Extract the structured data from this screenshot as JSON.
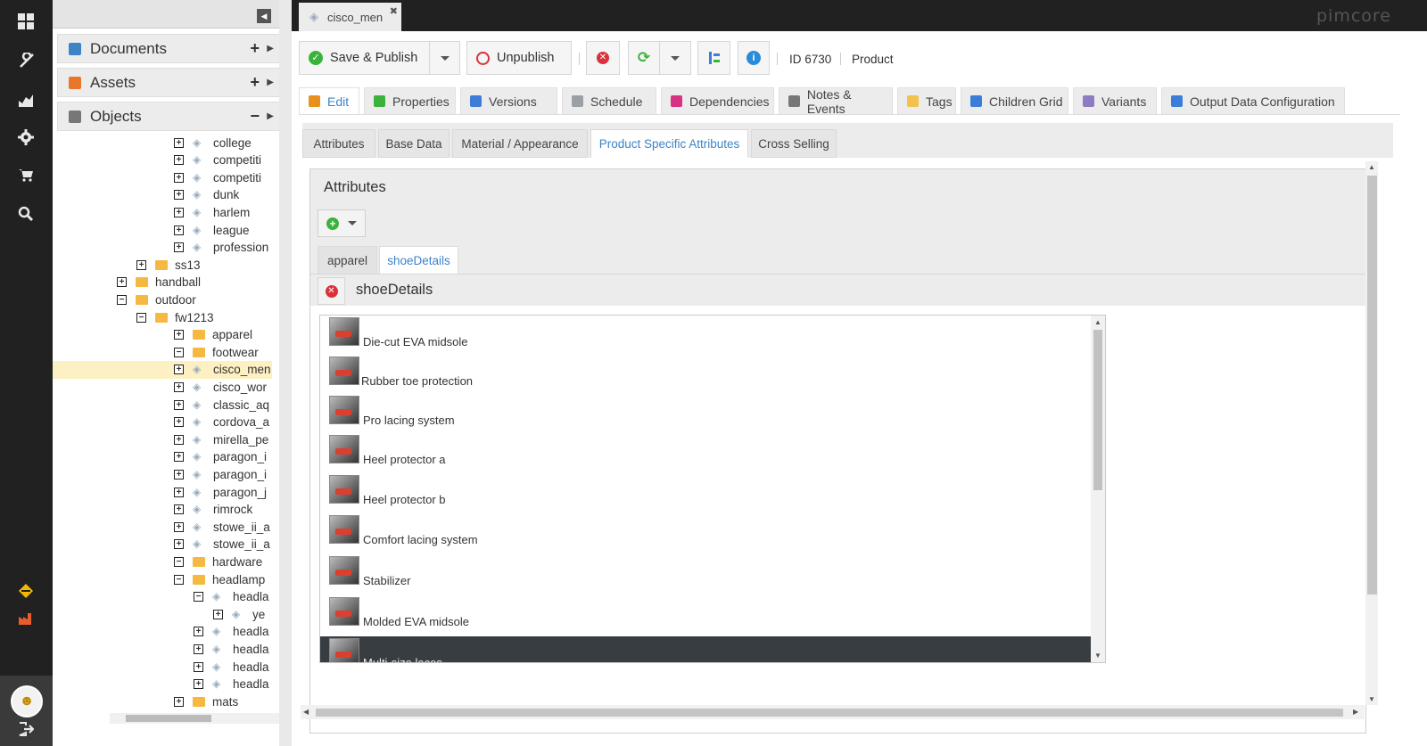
{
  "app": {
    "logo": "pimcore"
  },
  "doc_tab": {
    "title": "cisco_men",
    "close": "✖"
  },
  "accordion": {
    "documents": "Documents",
    "assets": "Assets",
    "objects": "Objects"
  },
  "tree": [
    {
      "label": "college",
      "toggle": "+",
      "icon": "tag",
      "indent": 3
    },
    {
      "label": "competiti",
      "toggle": "+",
      "icon": "tag",
      "indent": 3
    },
    {
      "label": "competiti",
      "toggle": "+",
      "icon": "tag",
      "indent": 3
    },
    {
      "label": "dunk",
      "toggle": "+",
      "icon": "tag",
      "indent": 3
    },
    {
      "label": "harlem",
      "toggle": "+",
      "icon": "tag",
      "indent": 3
    },
    {
      "label": "league",
      "toggle": "+",
      "icon": "tag",
      "indent": 3
    },
    {
      "label": "profession",
      "toggle": "+",
      "icon": "tag",
      "indent": 3
    },
    {
      "label": "ss13",
      "toggle": "+",
      "icon": "folder",
      "indent": 2
    },
    {
      "label": "handball",
      "toggle": "+",
      "icon": "folder",
      "indent": 1
    },
    {
      "label": "outdoor",
      "toggle": "−",
      "icon": "folder",
      "indent": 1
    },
    {
      "label": "fw1213",
      "toggle": "−",
      "icon": "folder",
      "indent": 2
    },
    {
      "label": "apparel",
      "toggle": "+",
      "icon": "folder",
      "indent": 3
    },
    {
      "label": "footwear",
      "toggle": "−",
      "icon": "folder",
      "indent": 3
    },
    {
      "label": "cisco_men",
      "toggle": "+",
      "icon": "tag",
      "indent": 4,
      "selected": true
    },
    {
      "label": "cisco_wor",
      "toggle": "+",
      "icon": "tag",
      "indent": 4
    },
    {
      "label": "classic_aq",
      "toggle": "+",
      "icon": "tag",
      "indent": 4
    },
    {
      "label": "cordova_a",
      "toggle": "+",
      "icon": "tag",
      "indent": 4
    },
    {
      "label": "mirella_pe",
      "toggle": "+",
      "icon": "tag",
      "indent": 4
    },
    {
      "label": "paragon_i",
      "toggle": "+",
      "icon": "tag",
      "indent": 4
    },
    {
      "label": "paragon_i",
      "toggle": "+",
      "icon": "tag",
      "indent": 4
    },
    {
      "label": "paragon_j",
      "toggle": "+",
      "icon": "tag",
      "indent": 4
    },
    {
      "label": "rimrock",
      "toggle": "+",
      "icon": "tag",
      "indent": 4
    },
    {
      "label": "stowe_ii_a",
      "toggle": "+",
      "icon": "tag",
      "indent": 4
    },
    {
      "label": "stowe_ii_a",
      "toggle": "+",
      "icon": "tag",
      "indent": 4
    },
    {
      "label": "hardware",
      "toggle": "−",
      "icon": "folder",
      "indent": 3
    },
    {
      "label": "headlamp",
      "toggle": "−",
      "icon": "folder",
      "indent": 4
    },
    {
      "label": "headla",
      "toggle": "−",
      "icon": "tag",
      "indent": 5
    },
    {
      "label": "ye",
      "toggle": "+",
      "icon": "tag",
      "indent": 6
    },
    {
      "label": "headla",
      "toggle": "+",
      "icon": "tag",
      "indent": 5
    },
    {
      "label": "headla",
      "toggle": "+",
      "icon": "tag",
      "indent": 5
    },
    {
      "label": "headla",
      "toggle": "+",
      "icon": "tag",
      "indent": 5
    },
    {
      "label": "headla",
      "toggle": "+",
      "icon": "tag",
      "indent": 5
    },
    {
      "label": "mats",
      "toggle": "+",
      "icon": "folder",
      "indent": 4
    }
  ],
  "toolbar": {
    "save_publish": "Save & Publish",
    "unpublish": "Unpublish",
    "id": "ID 6730",
    "type": "Product"
  },
  "tabs": [
    {
      "label": "Edit",
      "icon_color": "#e8901c",
      "active": true
    },
    {
      "label": "Properties",
      "icon_color": "#3bb33b"
    },
    {
      "label": "Versions",
      "icon_color": "#3b7dd8"
    },
    {
      "label": "Schedule",
      "icon_color": "#9aa0a6"
    },
    {
      "label": "Dependencies",
      "icon_color": "#d63384"
    },
    {
      "label": "Notes & Events",
      "icon_color": "#777777"
    },
    {
      "label": "Tags",
      "icon_color": "#f2c14e"
    },
    {
      "label": "Children Grid",
      "icon_color": "#3b7dd8"
    },
    {
      "label": "Variants",
      "icon_color": "#8e7cc3"
    },
    {
      "label": "Output Data Configuration",
      "icon_color": "#3b7dd8"
    }
  ],
  "subtabs": [
    {
      "label": "Attributes"
    },
    {
      "label": "Base Data"
    },
    {
      "label": "Material / Appearance"
    },
    {
      "label": "Product Specific Attributes",
      "active": true
    },
    {
      "label": "Cross Selling"
    }
  ],
  "attributes": {
    "title": "Attributes",
    "inner_tabs": [
      {
        "label": "apparel"
      },
      {
        "label": "shoeDetails",
        "active": true
      }
    ],
    "section_title": "shoeDetails",
    "items": [
      "Die-cut EVA midsole",
      "Rubber toe protection",
      "Pro lacing system",
      "Heel protector a",
      "Heel protector b",
      "Comfort lacing system",
      "Stabilizer",
      "Molded EVA midsole",
      "Multi-size laces"
    ]
  }
}
